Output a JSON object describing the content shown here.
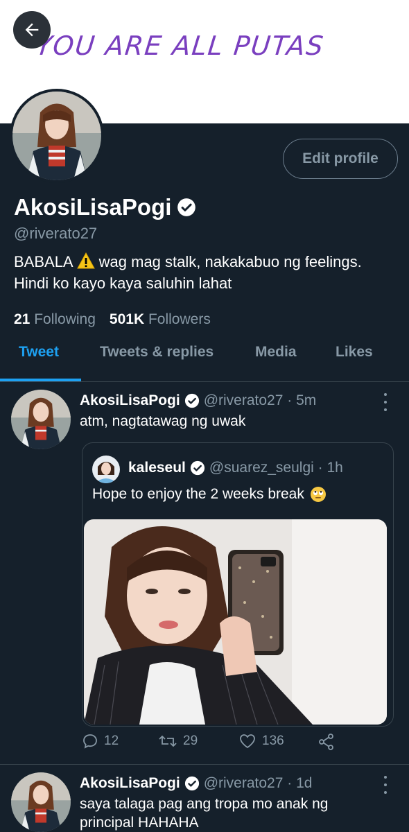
{
  "banner": {
    "text": "YOU ARE ALL PUTAS"
  },
  "profile": {
    "display_name": "AkosiLisaPogi",
    "handle": "@riverato27",
    "bio_before_emoji": "BABALA",
    "bio_after_emoji": "wag mag stalk, nakakabuo ng feelings. Hindi ko kayo kaya saluhin lahat",
    "following_count": "21",
    "following_label": "Following",
    "followers_count": "501K",
    "followers_label": "Followers",
    "edit_button": "Edit profile"
  },
  "tabs": [
    {
      "label": "Tweet"
    },
    {
      "label": "Tweets & replies"
    },
    {
      "label": "Media"
    },
    {
      "label": "Likes"
    }
  ],
  "tweets": [
    {
      "name": "AkosiLisaPogi",
      "handle_time": "@riverato27 · 5m",
      "text": "atm, nagtatawag ng uwak",
      "quote": {
        "name": "kaleseul",
        "handle_time": "@suarez_seulgi · 1h",
        "text": "Hope to enjoy the 2 weeks break"
      },
      "replies": "12",
      "retweets": "29",
      "likes": "136"
    },
    {
      "name": "AkosiLisaPogi",
      "handle_time": "@riverato27 · 1d",
      "text": "saya talaga pag ang tropa mo anak ng principal HAHAHA"
    }
  ],
  "colors": {
    "background": "#15202b",
    "accent": "#1da1f2",
    "muted": "#8899a6",
    "banner_text": "#7a3fbf"
  },
  "icons": [
    "back-arrow-icon",
    "verified-badge-icon",
    "warning-emoji-icon",
    "more-options-icon",
    "reply-icon",
    "retweet-icon",
    "like-icon",
    "share-icon",
    "eye-roll-emoji-icon"
  ]
}
